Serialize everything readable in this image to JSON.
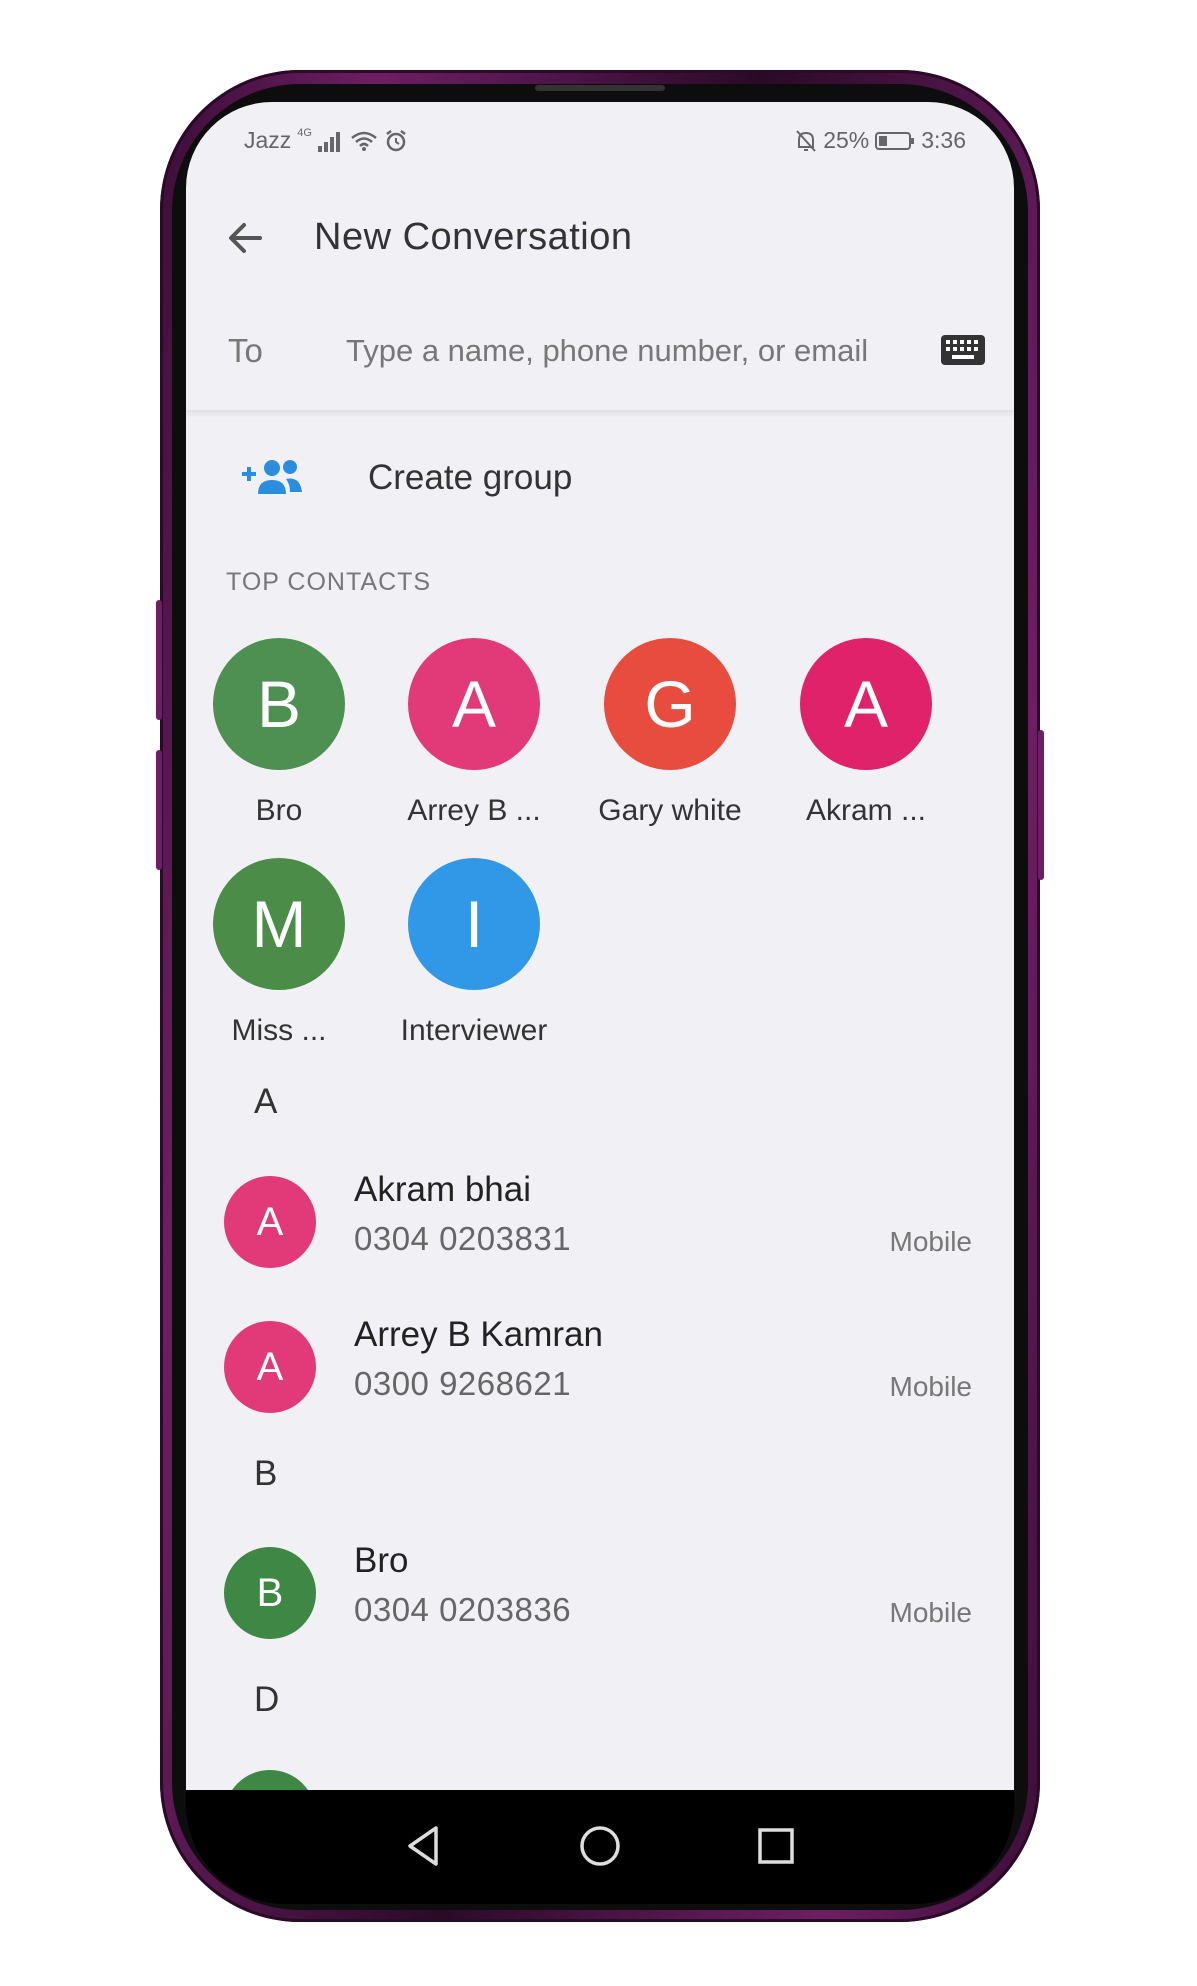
{
  "status_bar": {
    "carrier": "Jazz",
    "network": "4G",
    "battery": "25%",
    "time": "3:36",
    "icons": [
      "signal-icon",
      "wifi-icon",
      "alarm-icon",
      "mute-icon",
      "battery-icon"
    ]
  },
  "header": {
    "title": "New Conversation",
    "back_icon": "arrow-left-icon"
  },
  "to_field": {
    "label": "To",
    "placeholder": "Type a name, phone number, or email",
    "value": "",
    "keyboard_icon": "keyboard-icon"
  },
  "create_group": {
    "label": "Create group",
    "icon": "add-group-icon"
  },
  "top_contacts": {
    "heading": "TOP CONTACTS",
    "items": [
      {
        "initial": "B",
        "name": "Bro",
        "color": "#4e8f52"
      },
      {
        "initial": "A",
        "name": "Arrey B ...",
        "color": "#e23a78"
      },
      {
        "initial": "G",
        "name": "Gary white",
        "color": "#e84c3f"
      },
      {
        "initial": "A",
        "name": "Akram ...",
        "color": "#e0226b"
      },
      {
        "initial": "M",
        "name": "Miss ...",
        "color": "#4a8c48"
      },
      {
        "initial": "I",
        "name": "Interviewer",
        "color": "#3198e8"
      }
    ]
  },
  "contacts": {
    "sections": [
      {
        "letter": "A",
        "items": [
          {
            "initial": "A",
            "name": "Akram bhai",
            "phone": "0304 0203831",
            "type": "Mobile",
            "color": "#e23a78"
          },
          {
            "initial": "A",
            "name": "Arrey B Kamran",
            "phone": "0300 9268621",
            "type": "Mobile",
            "color": "#e23a78"
          }
        ]
      },
      {
        "letter": "B",
        "items": [
          {
            "initial": "B",
            "name": "Bro",
            "phone": "0304 0203836",
            "type": "Mobile",
            "color": "#3f8744"
          }
        ]
      },
      {
        "letter": "D",
        "items": []
      }
    ]
  },
  "nav_bar": {
    "buttons": [
      "back-triangle-icon",
      "home-circle-icon",
      "recents-square-icon"
    ]
  },
  "colors": {
    "accent": "#2b8de0",
    "screen_bg": "#f1f1f5",
    "frame": "#6d1e64"
  }
}
